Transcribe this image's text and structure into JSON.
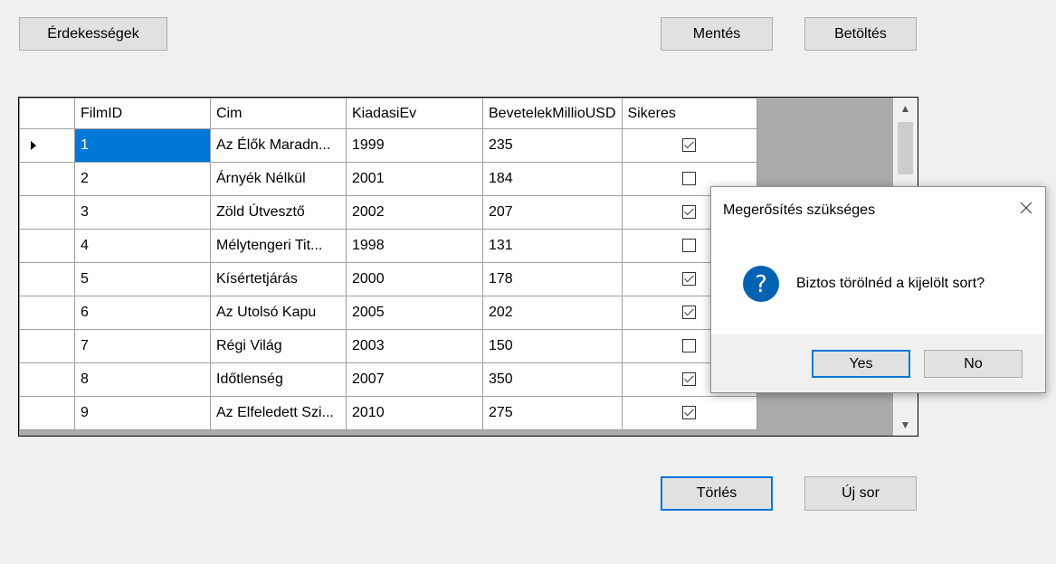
{
  "toolbar": {
    "interests_label": "Érdekességek",
    "save_label": "Mentés",
    "load_label": "Betöltés"
  },
  "grid": {
    "columns": [
      "FilmID",
      "Cim",
      "KiadasiEv",
      "BevetelekMillioUSD",
      "Sikeres"
    ],
    "rows": [
      {
        "id": "1",
        "cim": "Az Élők Maradn...",
        "ev": "1999",
        "bevetel": "235",
        "sikeres": true
      },
      {
        "id": "2",
        "cim": "Árnyék Nélkül",
        "ev": "2001",
        "bevetel": "184",
        "sikeres": false
      },
      {
        "id": "3",
        "cim": "Zöld Útvesztő",
        "ev": "2002",
        "bevetel": "207",
        "sikeres": true
      },
      {
        "id": "4",
        "cim": "Mélytengeri Tit...",
        "ev": "1998",
        "bevetel": "131",
        "sikeres": false
      },
      {
        "id": "5",
        "cim": "Kísértetjárás",
        "ev": "2000",
        "bevetel": "178",
        "sikeres": true
      },
      {
        "id": "6",
        "cim": "Az Utolsó Kapu",
        "ev": "2005",
        "bevetel": "202",
        "sikeres": true
      },
      {
        "id": "7",
        "cim": "Régi Világ",
        "ev": "2003",
        "bevetel": "150",
        "sikeres": false
      },
      {
        "id": "8",
        "cim": "Időtlenség",
        "ev": "2007",
        "bevetel": "350",
        "sikeres": true
      },
      {
        "id": "9",
        "cim": "Az Elfeledett Szi...",
        "ev": "2010",
        "bevetel": "275",
        "sikeres": true
      }
    ]
  },
  "actions": {
    "delete_label": "Törlés",
    "new_row_label": "Új sor"
  },
  "dialog": {
    "title": "Megerősítés szükséges",
    "message": "Biztos törölnéd a kijelölt sort?",
    "yes_label": "Yes",
    "no_label": "No"
  },
  "colors": {
    "selection": "#0078d7",
    "question_icon": "#0063b1"
  }
}
